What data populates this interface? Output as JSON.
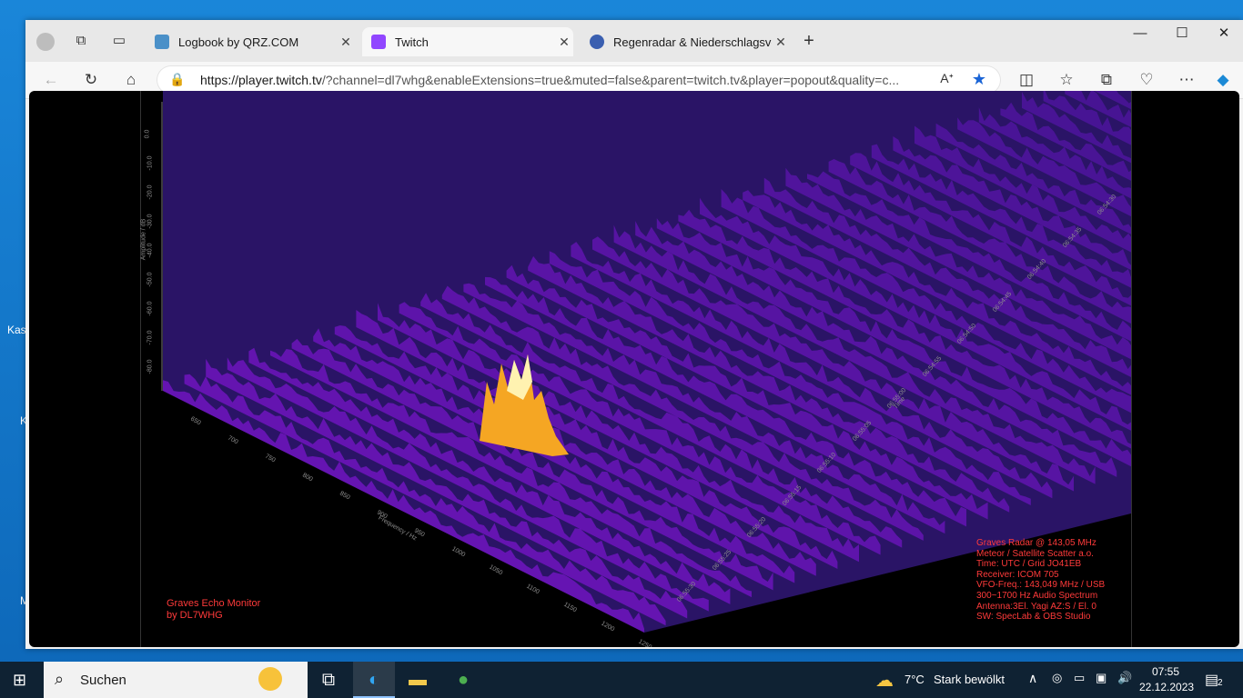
{
  "browser": {
    "tabs": [
      {
        "title": "Logbook by QRZ.COM",
        "favicon_color": "#4a90c8"
      },
      {
        "title": "Twitch",
        "favicon_color": "#9146ff",
        "active": true
      },
      {
        "title": "Regenradar & Niederschlagsvorh",
        "favicon_color": "#3a5fb0"
      }
    ],
    "new_tab_label": "+",
    "url_host": "https://player.twitch.tv",
    "url_rest": "/?channel=dl7whg&enableExtensions=true&muted=false&parent=twitch.tv&player=popout&quality=c...",
    "star_color": "#1a64d6"
  },
  "stream": {
    "left_title": [
      "Graves Echo Monitor",
      "by DL7WHG"
    ],
    "right_info": [
      "Graves Radar @ 143,05 MHz",
      "Meteor / Satellite Scatter a.o.",
      "Time: UTC / Grid JO41EB",
      "Receiver: ICOM 705",
      "VFO-Freq.: 143,049 MHz / USB",
      "300~1700 Hz Audio Spectrum",
      "Antenna:3El. Yagi AZ:S / El. 0",
      "SW: SpecLab & OBS Studio"
    ],
    "amp_axis_label": "Amplitude / dB",
    "amp_ticks": [
      "0.0",
      "-10.0",
      "-20.0",
      "-30.0",
      "-40.0",
      "-50.0",
      "-60.0",
      "-70.0",
      "-80.0"
    ],
    "freq_axis_label": "Frequency / Hz",
    "freq_ticks": [
      "650",
      "700",
      "750",
      "800",
      "850",
      "900",
      "950",
      "1000",
      "1050",
      "1100",
      "1150",
      "1200",
      "1250"
    ],
    "time_axis_label": "Time",
    "time_ticks": [
      "06:55:30",
      "06:55:25",
      "06:55:20",
      "06:55:15",
      "06:55:10",
      "06:55:05",
      "06:55:00",
      "06:54:55",
      "06:54:50",
      "06:54:45",
      "06:54:40",
      "06:54:35",
      "06:54:30"
    ],
    "text_color": "#ff3a3a"
  },
  "desktop": {
    "frag1": "Kas",
    "frag2": "K",
    "frag3": "M"
  },
  "taskbar": {
    "search_label": "Suchen",
    "weather_temp": "7°C",
    "weather_text": "Stark bewölkt",
    "time": "07:55",
    "date": "22.12.2023",
    "notifications": "2"
  }
}
